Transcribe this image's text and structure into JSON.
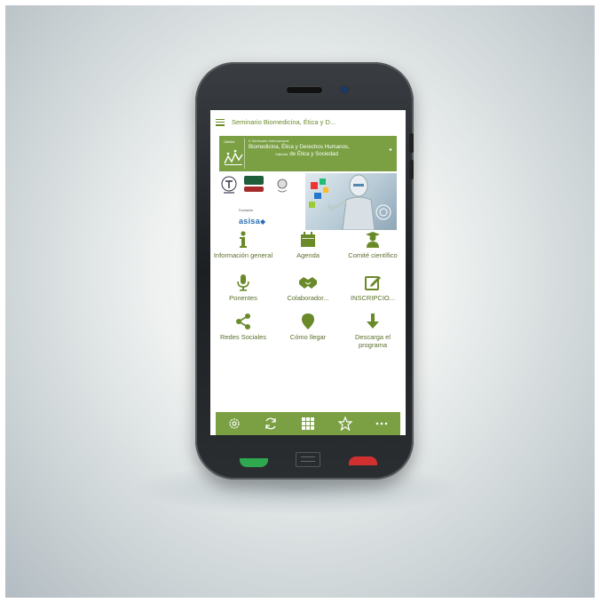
{
  "app": {
    "title": "Seminario Biomedicina, Ética y D..."
  },
  "banner": {
    "logo_label": "Cátedra",
    "top_line": "II Seminario Internacional",
    "line1": "Biomedicina, Ética y Derechos Humanos,",
    "line2_prefix": "Cátedra",
    "line2": "de Ética y Sociedad"
  },
  "sponsors": {
    "asisa_caption": "Fundación",
    "asisa_word": "asisa"
  },
  "menu": [
    {
      "label": "Información general",
      "icon": "info-icon"
    },
    {
      "label": "Agenda",
      "icon": "calendar-icon"
    },
    {
      "label": "Comité científico",
      "icon": "graduate-icon"
    },
    {
      "label": "Ponentes",
      "icon": "microphone-icon"
    },
    {
      "label": "Colaborador...",
      "icon": "handshake-icon"
    },
    {
      "label": "INSCRIPCIO...",
      "icon": "edit-icon"
    },
    {
      "label": "Redes Sociales",
      "icon": "share-icon"
    },
    {
      "label": "Cómo llegar",
      "icon": "map-pin-icon"
    },
    {
      "label": "Descarga el programa",
      "icon": "download-icon"
    }
  ],
  "bottom_nav": [
    "settings-icon",
    "refresh-icon",
    "grid-icon",
    "star-icon",
    "more-icon"
  ],
  "colors": {
    "accent": "#7aa043",
    "icon": "#6a8a2a",
    "call_green": "#2fa84f",
    "end_red": "#d03030"
  }
}
